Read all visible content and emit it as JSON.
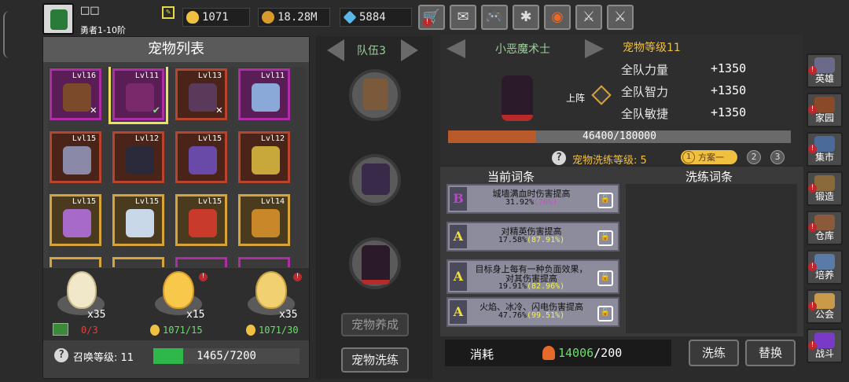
{
  "player": {
    "name": "□□",
    "title": "勇者1-10阶"
  },
  "resources": [
    {
      "name": "gold-egg",
      "value": "1071",
      "color": "#f0c040"
    },
    {
      "name": "coin",
      "value": "18.28M",
      "color": "#d89a2a"
    },
    {
      "name": "gem",
      "value": "5884",
      "color": "#5ab8e8"
    }
  ],
  "toolbar": {
    "shop": "🛒",
    "mail": "✉",
    "gamepad": "🎮",
    "settings": "✱",
    "color": "◉",
    "weapon1": "⚔",
    "weapon2": "⚔"
  },
  "pet_list": {
    "title": "宠物列表",
    "slots": [
      {
        "lv": "Lvl16",
        "rarity": "purple",
        "color": "#7a4a2a",
        "mark": "✕"
      },
      {
        "lv": "Lvl11",
        "rarity": "purple",
        "color": "#7a2a6a",
        "mark": "✔"
      },
      {
        "lv": "Lvl13",
        "rarity": "red",
        "color": "#5a3a5a",
        "mark": "✕"
      },
      {
        "lv": "Lvl11",
        "rarity": "purple",
        "color": "#8aa8d8",
        "mark": ""
      },
      {
        "lv": "Lvl15",
        "rarity": "red",
        "color": "#8a8aa8",
        "mark": ""
      },
      {
        "lv": "Lvl12",
        "rarity": "red",
        "color": "#2a2a3a",
        "mark": ""
      },
      {
        "lv": "Lvl15",
        "rarity": "red",
        "color": "#6a4aa8",
        "mark": ""
      },
      {
        "lv": "Lvl12",
        "rarity": "red",
        "color": "#c8a83a",
        "mark": ""
      },
      {
        "lv": "Lvl15",
        "rarity": "gold",
        "color": "#a86ac8",
        "mark": ""
      },
      {
        "lv": "Lvl15",
        "rarity": "gold",
        "color": "#c8d8e8",
        "mark": ""
      },
      {
        "lv": "Lvl15",
        "rarity": "gold",
        "color": "#c83a2a",
        "mark": ""
      },
      {
        "lv": "Lvl14",
        "rarity": "gold",
        "color": "#c8882a",
        "mark": ""
      }
    ]
  },
  "eggs": [
    {
      "count": "x35",
      "label": "0/3",
      "label_color": "#e04040"
    },
    {
      "count": "x15",
      "label": "1071/15",
      "label_color": "#6ae06a"
    },
    {
      "count": "x35",
      "label": "1071/30",
      "label_color": "#6ae06a"
    }
  ],
  "summon": {
    "label": "召唤等级: 11",
    "progress": "1465/7200",
    "fraction": 0.2035
  },
  "team": {
    "title": "队伍3",
    "btn_cultivate": "宠物养成",
    "btn_wash": "宠物洗练"
  },
  "pet_detail": {
    "name": "小恶魔术士",
    "level": "宠物等级11",
    "deploy": "上阵",
    "stats": [
      {
        "label": "全队力量",
        "value": "+1350"
      },
      {
        "label": "全队智力",
        "value": "+1350"
      },
      {
        "label": "全队敏捷",
        "value": "+1350"
      }
    ],
    "exp": "46400/180000",
    "exp_fraction": 0.2578,
    "wash_level": "宠物洗练等级: 5",
    "plan_num": "1",
    "plan_label": "方案一",
    "plan2": "2",
    "plan3": "3"
  },
  "affixes": {
    "current_title": "当前词条",
    "wash_title": "洗练词条",
    "items": [
      {
        "grade": "B",
        "grade_color": "#c040d0",
        "line1": "城墙满血时伤害提高",
        "line2a": "31.92%",
        "line2b": "(76%)",
        "hl": "pct"
      },
      {
        "grade": "A",
        "grade_color": "#f0e040",
        "line1": "对精英伤害提高",
        "line2a": "17.58%",
        "line2b": "(87.91%)",
        "hl": "pct y"
      },
      {
        "grade": "A",
        "grade_color": "#f0e040",
        "line1": "目标身上每有一种负面效果，",
        "line1b": "对其伤害提高",
        "line2a": "19.91%",
        "line2b": "(82.96%)",
        "hl": "pct y"
      },
      {
        "grade": "A",
        "grade_color": "#f0e040",
        "line1": "火焰、冰冷、闪电伤害提高",
        "line2a": "47.76%",
        "line2b": "(99.51%)",
        "hl": "pct y"
      }
    ]
  },
  "cost": {
    "label": "消耗",
    "value": "14006",
    "max": "/200"
  },
  "actions": {
    "wash": "洗练",
    "replace": "替换"
  },
  "side_menu": [
    {
      "label": "英雄",
      "color": "#6a6a8a",
      "alert": true
    },
    {
      "label": "家园",
      "color": "#8a4a2a",
      "alert": true
    },
    {
      "label": "集市",
      "color": "#4a6a9a",
      "alert": true
    },
    {
      "label": "锻造",
      "color": "#8a6a3a",
      "alert": true
    },
    {
      "label": "仓库",
      "color": "#8a5a3a",
      "alert": true
    },
    {
      "label": "培养",
      "color": "#5a7aa8",
      "alert": true
    },
    {
      "label": "公会",
      "color": "#c89a4a",
      "alert": true
    },
    {
      "label": "战斗",
      "color": "#7a3ac8",
      "alert": true
    }
  ]
}
